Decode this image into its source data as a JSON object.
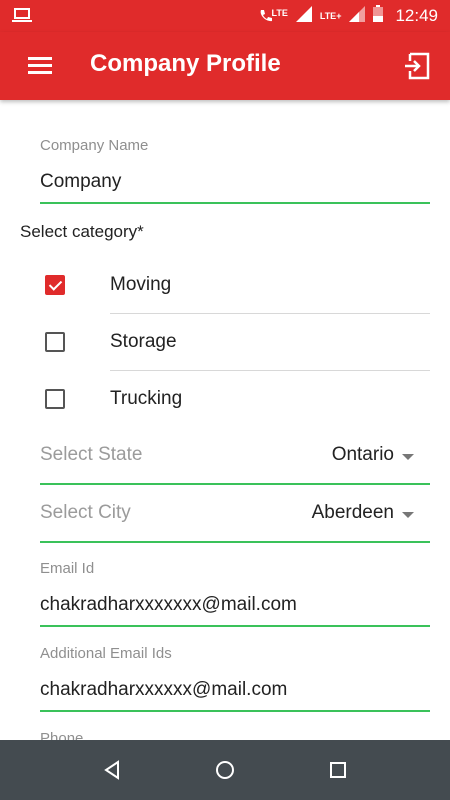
{
  "status_bar": {
    "lte_call_label": "LTE",
    "lte_plus_label": "LTE+",
    "time": "12:49"
  },
  "app_bar": {
    "title": "Company Profile"
  },
  "form": {
    "company_name": {
      "label": "Company Name",
      "value": "Company"
    },
    "category_title": "Select category*",
    "categories": [
      {
        "label": "Moving",
        "checked": true
      },
      {
        "label": "Storage",
        "checked": false
      },
      {
        "label": "Trucking",
        "checked": false
      }
    ],
    "state": {
      "hint": "Select State",
      "value": "Ontario"
    },
    "city": {
      "hint": "Select City",
      "value": "Aberdeen"
    },
    "email": {
      "label": "Email Id",
      "value": "chakradharxxxxxxx@mail.com"
    },
    "additional_email": {
      "label": "Additional Email Ids",
      "value": "chakradharxxxxxx@mail.com"
    },
    "phone": {
      "label": "Phone"
    }
  },
  "colors": {
    "accent": "#e02b2b",
    "underline": "#3ac25a",
    "nav_bar": "#444b50"
  },
  "icons": {
    "status_left": "laptop-icon",
    "menu": "hamburger-menu-icon",
    "exit": "exit-icon",
    "back": "back-triangle-icon",
    "home": "home-circle-icon",
    "recents": "recents-square-icon"
  }
}
